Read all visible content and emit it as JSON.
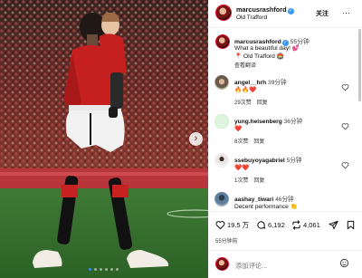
{
  "header": {
    "username": "marcusrashford",
    "location": "Old Trafford",
    "follow_label": "关注",
    "more": "…"
  },
  "caption": {
    "username": "marcusrashford",
    "time": "55分钟",
    "line1": "What a beautiful day! 💕",
    "line2": "📍 Old Trafford 🏟️",
    "translate": "查看翻译"
  },
  "comments": [
    {
      "username": "angel__hrh",
      "time": "39分钟",
      "text": "🔥🔥❤️",
      "likes": "29次赞",
      "reply": "回复"
    },
    {
      "username": "yung.heisenberg",
      "time": "36分钟",
      "text": "❤️",
      "likes": "8次赞",
      "reply": "回复"
    },
    {
      "username": "ssebuyoyagabriel",
      "time": "5分钟",
      "text": "❤️❤️",
      "likes": "1次赞",
      "reply": "回复"
    },
    {
      "username": "aashay_tiwari",
      "time": "46分钟",
      "text": "Decent performance 👏",
      "likes": "",
      "reply": ""
    }
  ],
  "actions": {
    "likes": "19.5 万",
    "comments": "6,192",
    "reposts": "4,061"
  },
  "post_time": "55分钟前",
  "add_comment_placeholder": "添加评论...",
  "colors": {
    "verified": "#3897f0",
    "dot_active": "#3b8ef0",
    "heart": "#e8354b"
  }
}
